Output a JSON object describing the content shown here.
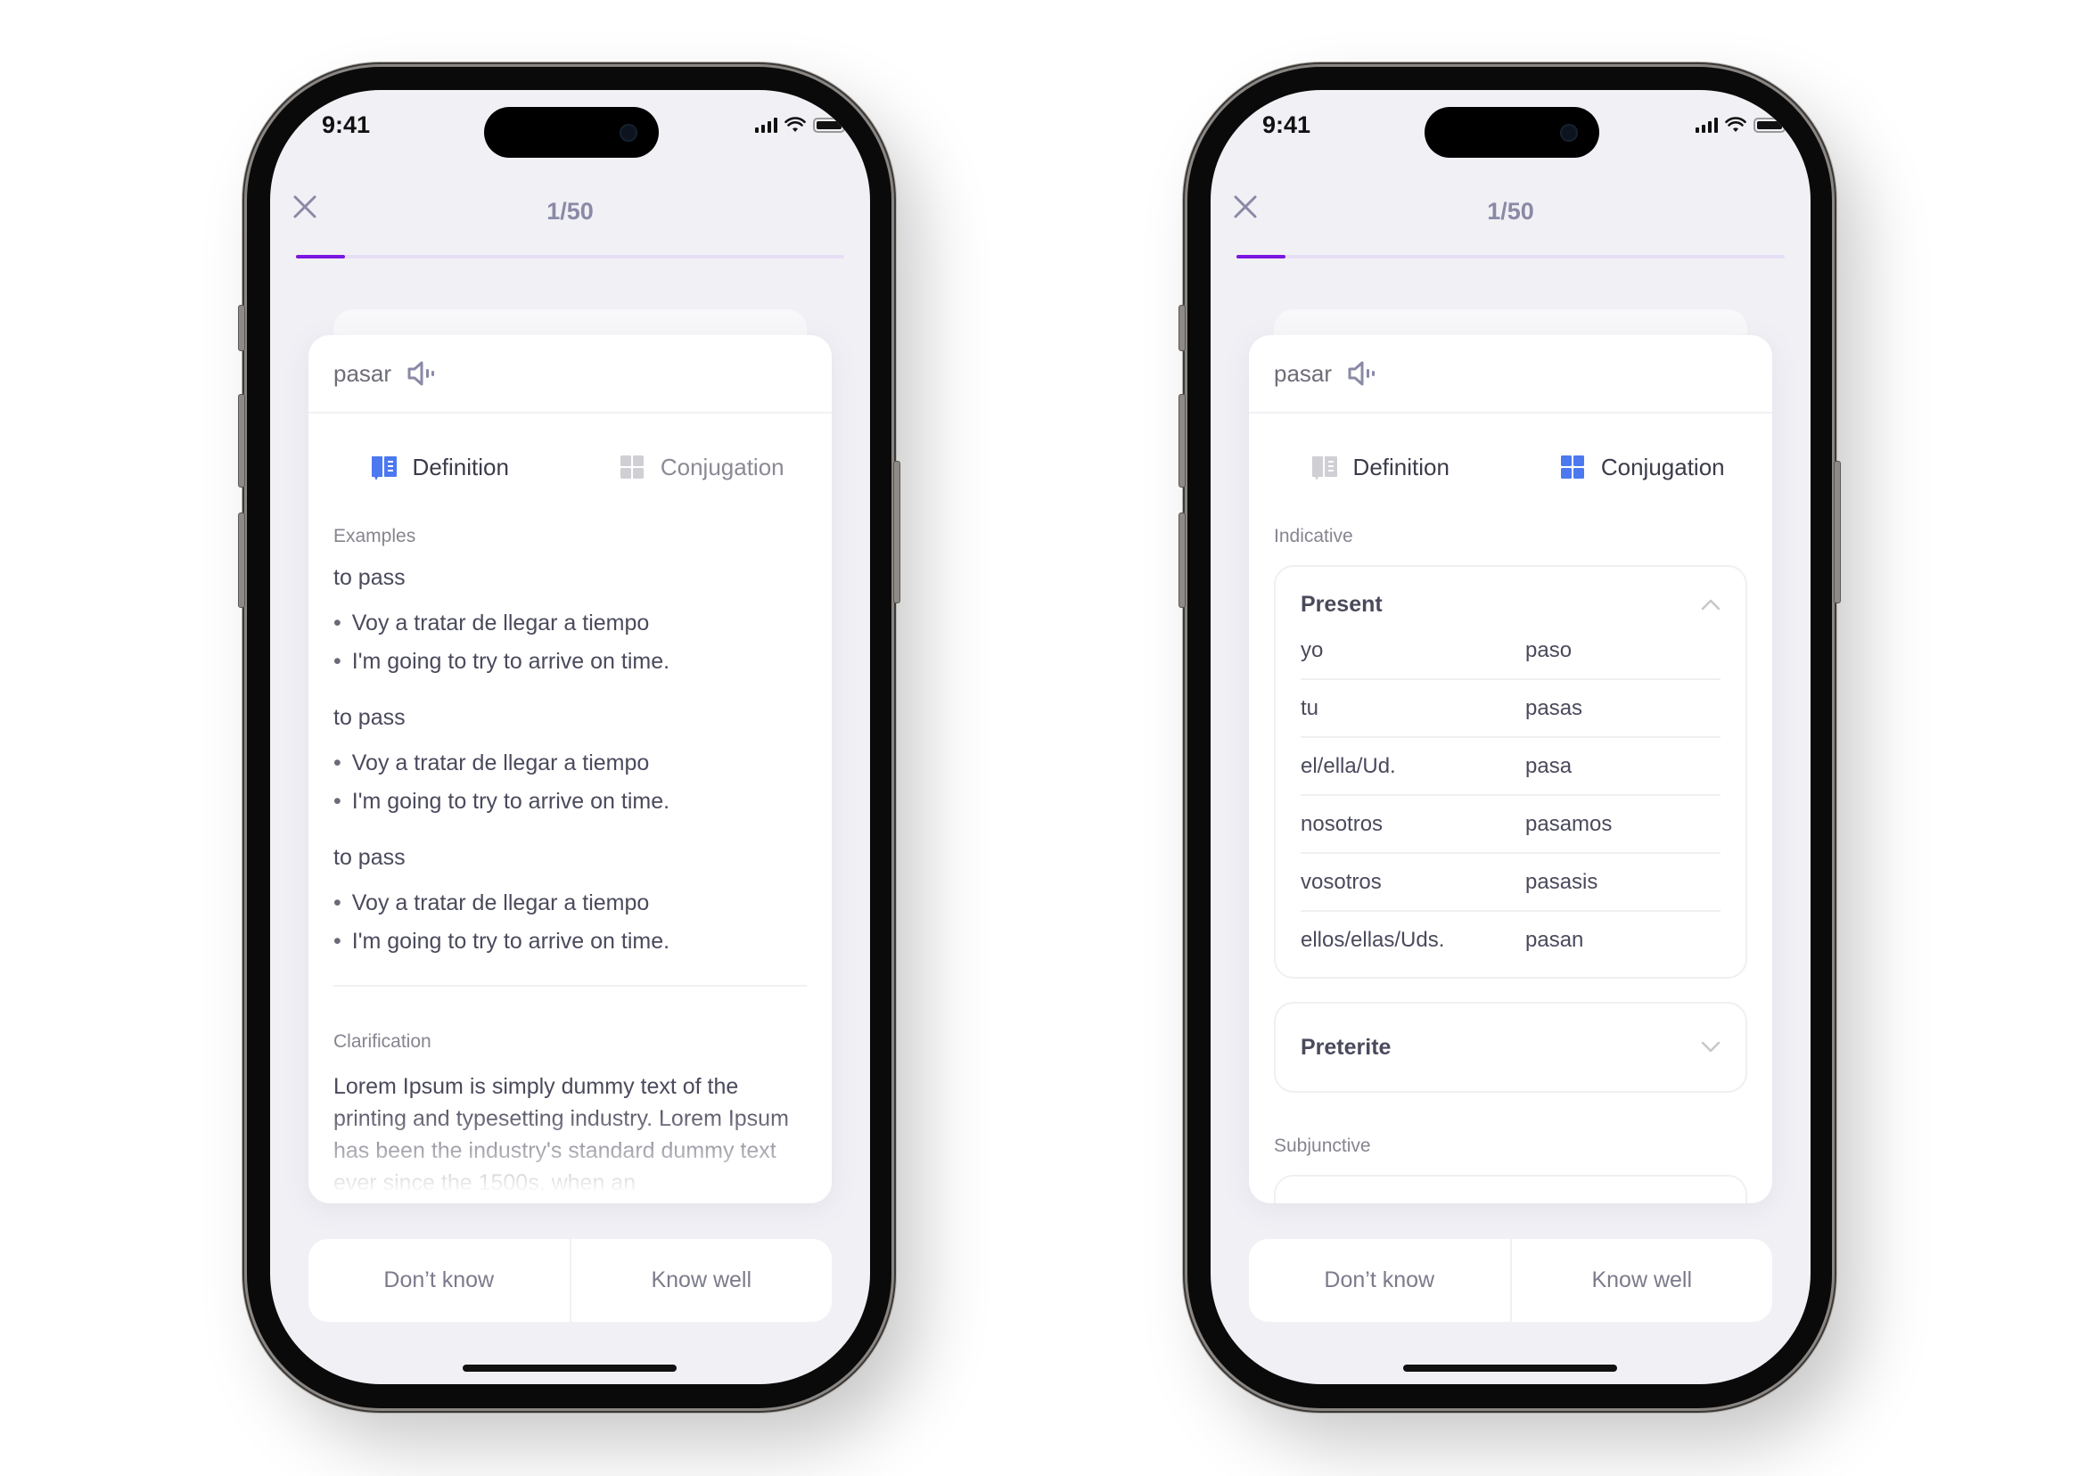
{
  "status_bar": {
    "time": "9:41",
    "icons": [
      "signal-icon",
      "wifi-icon",
      "battery-icon"
    ]
  },
  "header": {
    "close_icon": "close-icon",
    "counter": "1/50",
    "progress": {
      "current": 1,
      "total": 50,
      "visual_fill_fraction": 0.09
    }
  },
  "colors": {
    "accent_purple": "#7a17e0",
    "progress_track": "#e6def5",
    "tab_active_icon": "#4c78f0",
    "tab_inactive_icon": "#cfcfd4",
    "screen_bg": "#f1f0f5",
    "text_primary": "#4a4a5c",
    "text_muted": "#85858f"
  },
  "card": {
    "word": "pasar",
    "speaker_icon": "speaker-icon",
    "tabs": [
      {
        "label": "Definition",
        "icon": "book-icon"
      },
      {
        "label": "Conjugation",
        "icon": "grid-icon"
      }
    ]
  },
  "definition_screen": {
    "active_tab": "Definition",
    "examples_label": "Examples",
    "senses": [
      {
        "meaning": "to pass",
        "examples": [
          "Voy a tratar de llegar a tiempo",
          "I'm going to try to arrive on time."
        ]
      },
      {
        "meaning": "to pass",
        "examples": [
          "Voy a tratar de llegar a tiempo",
          "I'm going to try to arrive on time."
        ]
      },
      {
        "meaning": "to pass",
        "examples": [
          "Voy a tratar de llegar a tiempo",
          "I'm going to try to arrive on time."
        ]
      }
    ],
    "clarification_label": "Clarification",
    "clarification_text": "Lorem Ipsum is simply dummy text of the printing and typesetting industry. Lorem Ipsum has been the industry's standard dummy text ever since the 1500s, when an"
  },
  "conjugation_screen": {
    "active_tab": "Conjugation",
    "indicative_label": "Indicative",
    "present": {
      "title": "Present",
      "expanded": true,
      "rows": [
        {
          "pronoun": "yo",
          "form": "paso"
        },
        {
          "pronoun": "tu",
          "form": "pasas"
        },
        {
          "pronoun": "el/ella/Ud.",
          "form": "pasa"
        },
        {
          "pronoun": "nosotros",
          "form": "pasamos"
        },
        {
          "pronoun": "vosotros",
          "form": "pasasis"
        },
        {
          "pronoun": "ellos/ellas/Uds.",
          "form": "pasan"
        }
      ]
    },
    "preterite": {
      "title": "Preterite",
      "expanded": false
    },
    "subjunctive_label": "Subjunctive"
  },
  "actions": {
    "dont_know": "Don’t know",
    "know_well": "Know well"
  }
}
